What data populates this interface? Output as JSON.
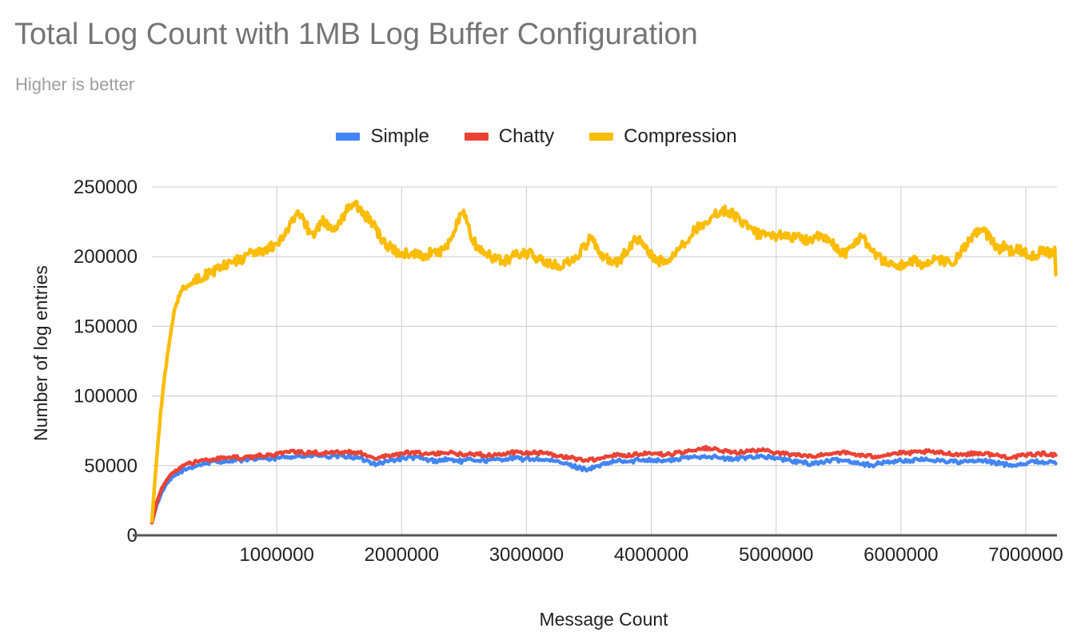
{
  "chart_data": {
    "type": "line",
    "title": "Total Log Count with 1MB Log Buffer Configuration",
    "subtitle": "Higher is better",
    "xlabel": "Message Count",
    "ylabel": "Number of log entries",
    "xlim": [
      0,
      7250000
    ],
    "ylim": [
      0,
      250000
    ],
    "grid": true,
    "legend_position": "top-center",
    "y_ticks": [
      0,
      50000,
      100000,
      150000,
      200000,
      250000
    ],
    "y_tick_labels": [
      "0",
      "50000",
      "100000",
      "150000",
      "200000",
      "250000"
    ],
    "x_ticks": [
      1000000,
      2000000,
      3000000,
      4000000,
      5000000,
      6000000,
      7000000
    ],
    "x_tick_labels": [
      "1000000",
      "2000000",
      "3000000",
      "4000000",
      "5000000",
      "6000000",
      "7000000"
    ],
    "colors": {
      "simple": "#4285f4",
      "chatty": "#ea4335",
      "compression": "#fbbc04",
      "title": "#757575",
      "subtitle": "#9e9e9e",
      "gridline": "#cccccc",
      "axisline": "#555555",
      "background": "#ffffff"
    },
    "series": [
      {
        "name": "Simple",
        "color": "#4285f4",
        "x": [
          0,
          40000,
          80000,
          120000,
          160000,
          200000,
          250000,
          300000,
          360000,
          420000,
          480000,
          540000,
          600000,
          670000,
          740000,
          810000,
          880000,
          950000,
          1020000,
          1090000,
          1160000,
          1230000,
          1300000,
          1370000,
          1440000,
          1510000,
          1580000,
          1650000,
          1720000,
          1790000,
          1860000,
          1930000,
          2000000,
          2070000,
          2140000,
          2210000,
          2280000,
          2350000,
          2420000,
          2490000,
          2560000,
          2630000,
          2700000,
          2770000,
          2840000,
          2910000,
          2980000,
          3050000,
          3120000,
          3190000,
          3260000,
          3330000,
          3400000,
          3470000,
          3540000,
          3610000,
          3680000,
          3750000,
          3820000,
          3890000,
          3960000,
          4030000,
          4100000,
          4170000,
          4240000,
          4310000,
          4380000,
          4450000,
          4520000,
          4590000,
          4660000,
          4730000,
          4800000,
          4870000,
          4940000,
          5010000,
          5080000,
          5150000,
          5220000,
          5290000,
          5360000,
          5430000,
          5500000,
          5570000,
          5640000,
          5710000,
          5780000,
          5850000,
          5920000,
          5990000,
          6060000,
          6130000,
          6200000,
          6270000,
          6340000,
          6410000,
          6480000,
          6550000,
          6620000,
          6690000,
          6760000,
          6830000,
          6900000,
          6970000,
          7040000,
          7110000,
          7180000,
          7240000
        ],
        "y": [
          9000,
          22000,
          31000,
          37000,
          41000,
          44000,
          46500,
          48500,
          50000,
          51500,
          52500,
          53000,
          53500,
          54500,
          53500,
          54500,
          55500,
          54500,
          55500,
          56500,
          57000,
          56500,
          57500,
          57000,
          56000,
          57000,
          56500,
          55500,
          53500,
          51500,
          52500,
          54000,
          55000,
          56000,
          55500,
          54000,
          53500,
          54500,
          54000,
          53000,
          54500,
          54000,
          53500,
          54500,
          55000,
          55500,
          54500,
          55000,
          54500,
          53500,
          52500,
          51000,
          49000,
          47500,
          48500,
          50500,
          52500,
          53500,
          52500,
          54000,
          54500,
          54000,
          53500,
          54000,
          55000,
          56000,
          56500,
          57000,
          56000,
          55000,
          54500,
          55500,
          56500,
          57000,
          56000,
          55000,
          54000,
          53000,
          52000,
          51500,
          52500,
          53500,
          54000,
          53500,
          52500,
          51000,
          50500,
          52000,
          53000,
          53500,
          53500,
          54000,
          54500,
          54000,
          53500,
          53000,
          52500,
          53000,
          53500,
          53000,
          52000,
          51000,
          50500,
          51500,
          52500,
          53000,
          52500,
          51500
        ]
      },
      {
        "name": "Chatty",
        "color": "#ea4335",
        "x": [
          0,
          40000,
          80000,
          120000,
          160000,
          200000,
          250000,
          300000,
          360000,
          420000,
          480000,
          540000,
          600000,
          670000,
          740000,
          810000,
          880000,
          950000,
          1020000,
          1090000,
          1160000,
          1230000,
          1300000,
          1370000,
          1440000,
          1510000,
          1580000,
          1650000,
          1720000,
          1790000,
          1860000,
          1930000,
          2000000,
          2070000,
          2140000,
          2210000,
          2280000,
          2350000,
          2420000,
          2490000,
          2560000,
          2630000,
          2700000,
          2770000,
          2840000,
          2910000,
          2980000,
          3050000,
          3120000,
          3190000,
          3260000,
          3330000,
          3400000,
          3470000,
          3540000,
          3610000,
          3680000,
          3750000,
          3820000,
          3890000,
          3960000,
          4030000,
          4100000,
          4170000,
          4240000,
          4310000,
          4380000,
          4450000,
          4520000,
          4590000,
          4660000,
          4730000,
          4800000,
          4870000,
          4940000,
          5010000,
          5080000,
          5150000,
          5220000,
          5290000,
          5360000,
          5430000,
          5500000,
          5570000,
          5640000,
          5710000,
          5780000,
          5850000,
          5920000,
          5990000,
          6060000,
          6130000,
          6200000,
          6270000,
          6340000,
          6410000,
          6480000,
          6550000,
          6620000,
          6690000,
          6760000,
          6830000,
          6900000,
          6970000,
          7040000,
          7110000,
          7180000,
          7240000
        ],
        "y": [
          9000,
          24000,
          34000,
          40000,
          44000,
          47000,
          49500,
          51500,
          53000,
          54000,
          54500,
          55000,
          55500,
          56000,
          55500,
          56500,
          57500,
          57000,
          58500,
          59500,
          60000,
          59000,
          59500,
          59500,
          59000,
          60000,
          60000,
          59500,
          58000,
          55500,
          56500,
          57500,
          58500,
          59500,
          59000,
          58000,
          58500,
          59500,
          59000,
          58000,
          58500,
          58000,
          57500,
          58500,
          59000,
          59500,
          59000,
          59500,
          59000,
          58000,
          57000,
          56000,
          55000,
          54000,
          54500,
          56000,
          57500,
          58000,
          57500,
          58500,
          59000,
          58500,
          58000,
          58500,
          59500,
          61000,
          62000,
          62500,
          61500,
          60000,
          59500,
          60000,
          60500,
          61000,
          60500,
          59500,
          58500,
          58000,
          57000,
          56500,
          57500,
          59000,
          59500,
          59000,
          58000,
          57000,
          56500,
          57500,
          58500,
          59000,
          59000,
          59500,
          60000,
          59500,
          59000,
          58500,
          58000,
          58500,
          59000,
          58500,
          57500,
          56500,
          56000,
          57000,
          58000,
          58500,
          58500,
          57500
        ]
      },
      {
        "name": "Compression",
        "color": "#fbbc04",
        "x": [
          0,
          20000,
          45000,
          70000,
          100000,
          130000,
          160000,
          190000,
          220000,
          250000,
          280000,
          310000,
          345000,
          380000,
          415000,
          450000,
          490000,
          530000,
          570000,
          610000,
          650000,
          690000,
          730000,
          770000,
          810000,
          850000,
          890000,
          930000,
          970000,
          1010000,
          1050000,
          1090000,
          1130000,
          1170000,
          1210000,
          1250000,
          1290000,
          1330000,
          1370000,
          1410000,
          1450000,
          1490000,
          1530000,
          1570000,
          1610000,
          1650000,
          1690000,
          1730000,
          1770000,
          1810000,
          1850000,
          1890000,
          1930000,
          1970000,
          2010000,
          2060000,
          2110000,
          2160000,
          2210000,
          2260000,
          2310000,
          2360000,
          2410000,
          2450000,
          2490000,
          2530000,
          2570000,
          2620000,
          2670000,
          2720000,
          2770000,
          2820000,
          2870000,
          2920000,
          2970000,
          3020000,
          3070000,
          3120000,
          3170000,
          3220000,
          3270000,
          3320000,
          3370000,
          3420000,
          3470000,
          3520000,
          3570000,
          3620000,
          3670000,
          3710000,
          3750000,
          3790000,
          3840000,
          3890000,
          3940000,
          3990000,
          4040000,
          4090000,
          4140000,
          4190000,
          4240000,
          4290000,
          4340000,
          4390000,
          4440000,
          4490000,
          4540000,
          4590000,
          4640000,
          4690000,
          4740000,
          4790000,
          4840000,
          4890000,
          4940000,
          4990000,
          5040000,
          5090000,
          5140000,
          5190000,
          5240000,
          5290000,
          5340000,
          5390000,
          5440000,
          5490000,
          5540000,
          5590000,
          5640000,
          5690000,
          5740000,
          5790000,
          5840000,
          5890000,
          5940000,
          5990000,
          6040000,
          6090000,
          6140000,
          6190000,
          6240000,
          6290000,
          6340000,
          6390000,
          6440000,
          6490000,
          6540000,
          6590000,
          6640000,
          6690000,
          6740000,
          6790000,
          6840000,
          6890000,
          6940000,
          6990000,
          7040000,
          7090000,
          7140000,
          7190000,
          7240000
        ],
        "y": [
          10000,
          35000,
          62000,
          88000,
          112000,
          133000,
          152000,
          166000,
          172000,
          177000,
          180000,
          181500,
          183000,
          184500,
          186000,
          187500,
          189000,
          191000,
          193000,
          195000,
          196500,
          197500,
          199000,
          201000,
          202500,
          203500,
          204500,
          206000,
          207500,
          209500,
          214000,
          220000,
          226000,
          230000,
          227000,
          220000,
          216000,
          221000,
          227000,
          222000,
          219000,
          224000,
          229000,
          234000,
          239000,
          235000,
          231000,
          228000,
          223000,
          217000,
          212000,
          208000,
          205000,
          203000,
          202500,
          203000,
          202000,
          201000,
          202000,
          203000,
          204000,
          207000,
          215000,
          226000,
          232000,
          222000,
          212000,
          205000,
          202000,
          200000,
          198000,
          197000,
          199000,
          201000,
          203000,
          202000,
          200000,
          198000,
          196000,
          194000,
          193000,
          195000,
          198000,
          202000,
          208000,
          214000,
          205000,
          200000,
          198000,
          196000,
          197000,
          203000,
          209000,
          213000,
          207000,
          202000,
          198000,
          196000,
          198000,
          203000,
          208000,
          213000,
          218000,
          222000,
          226000,
          229000,
          232000,
          233000,
          231000,
          228000,
          224000,
          220000,
          217000,
          215000,
          214000,
          215000,
          216000,
          215000,
          214000,
          213000,
          212000,
          213000,
          214000,
          213000,
          210000,
          206000,
          202000,
          205000,
          211000,
          216000,
          208000,
          202000,
          198000,
          196000,
          194000,
          193000,
          195000,
          197000,
          196000,
          194000,
          196000,
          198000,
          197000,
          195000,
          198000,
          204000,
          210000,
          215000,
          221000,
          216000,
          210000,
          205000,
          208000,
          203000,
          206000,
          203000,
          200000,
          202000,
          205000,
          203000,
          206000,
          202000,
          199000,
          196000,
          187000
        ]
      }
    ]
  }
}
